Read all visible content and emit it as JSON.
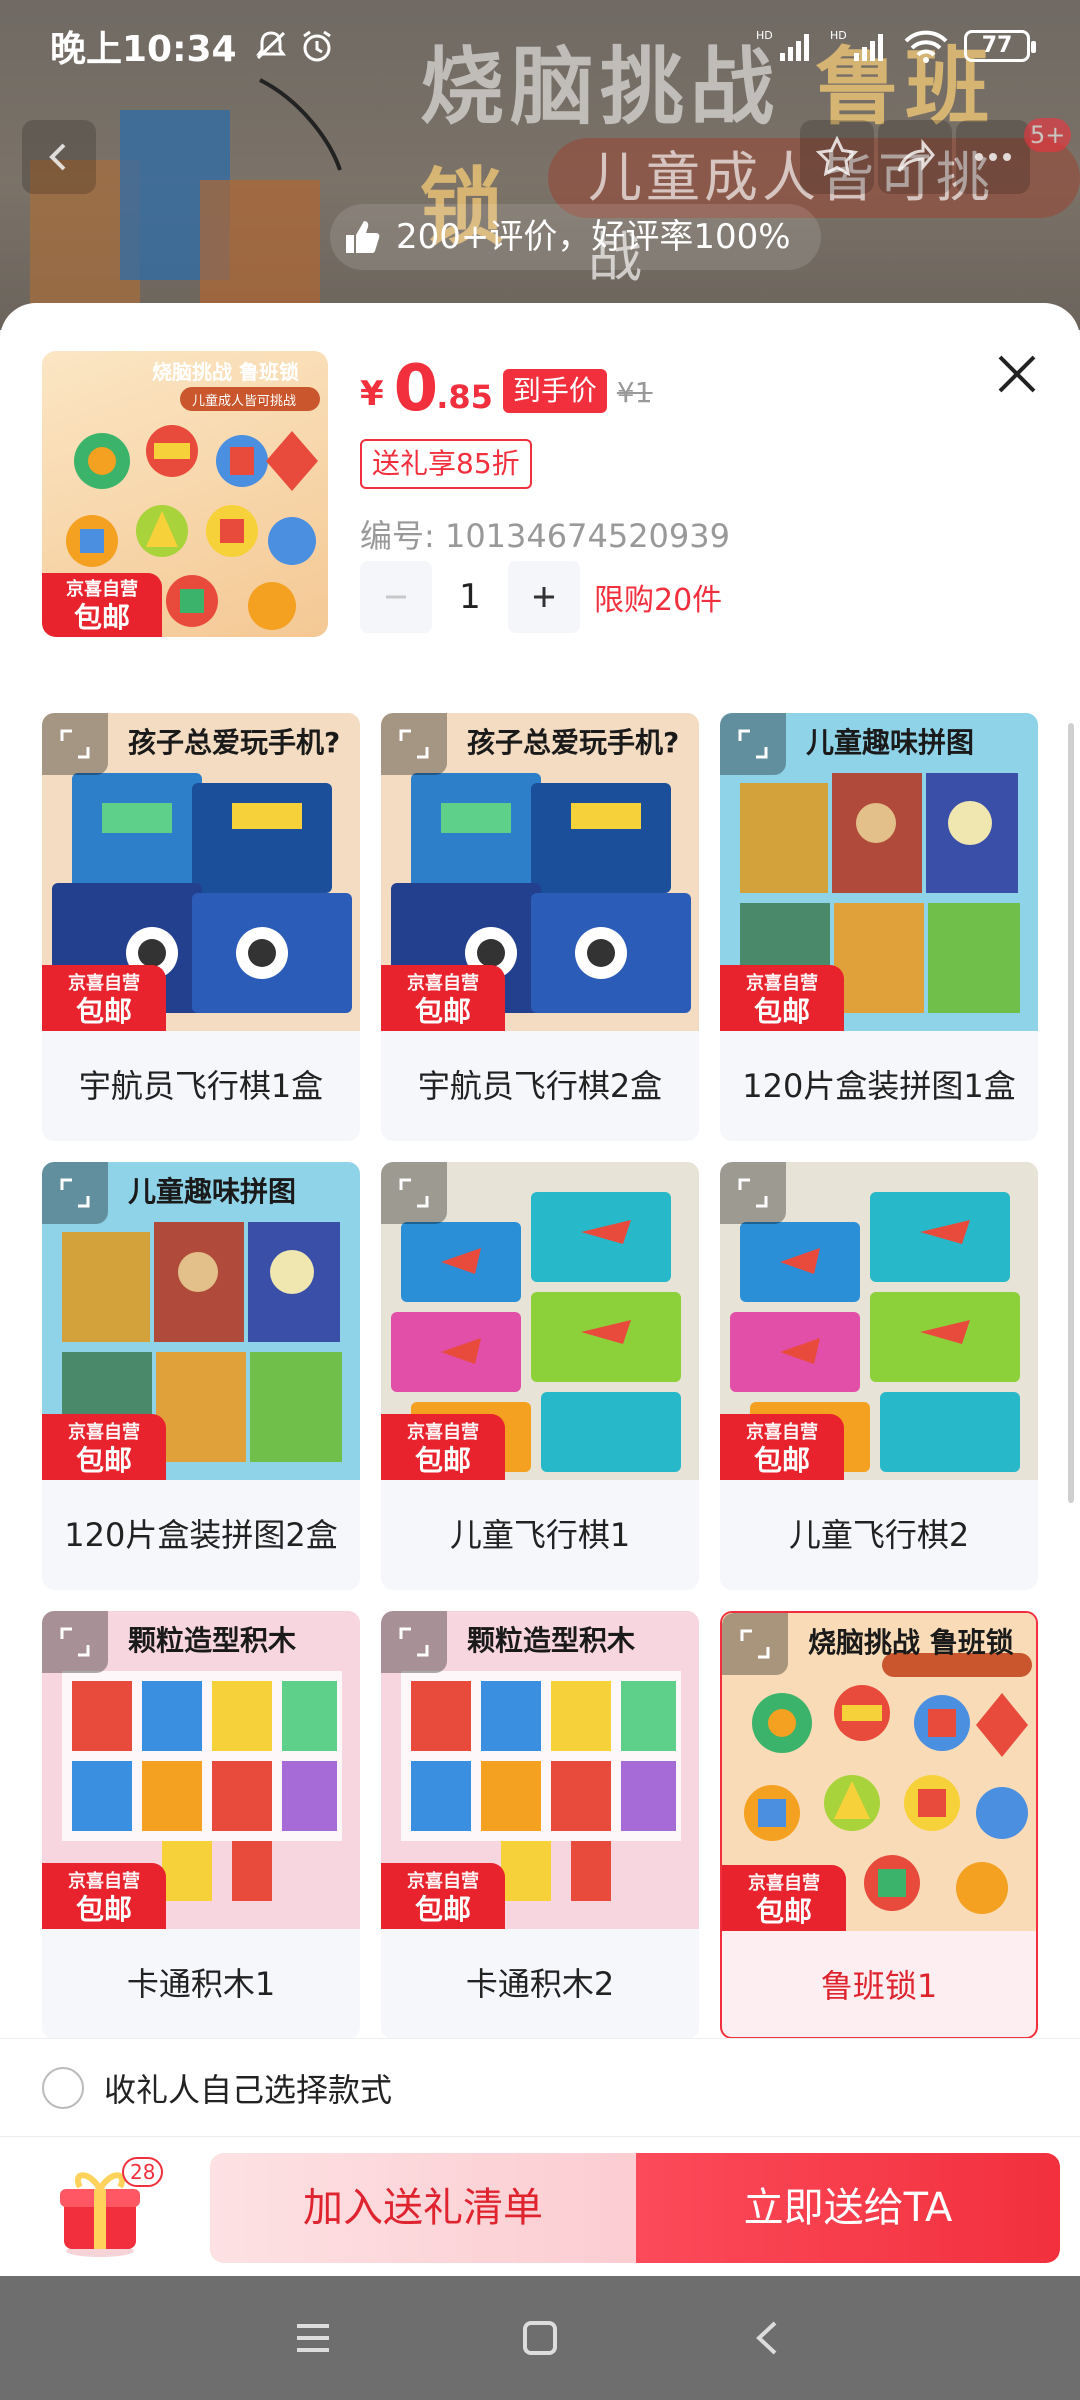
{
  "status_bar": {
    "time": "晚上10:34",
    "battery": "77"
  },
  "backdrop": {
    "title_main": "烧脑挑战",
    "title_highlight": "鲁班锁",
    "subtitle": "儿童成人皆可挑战",
    "review": "200+评价，好评率100%",
    "more_badge": "5+"
  },
  "product": {
    "currency": "¥",
    "price_int": "0",
    "price_dec": ".85",
    "final_price_tag": "到手价",
    "original_price": "¥1",
    "gift_discount": "送礼享85折",
    "sku_label": "编号: 10134674520939",
    "quantity": "1",
    "limit": "限购20件",
    "thumb_caption": "烧脑挑战 鲁班锁",
    "thumb_subcaption": "儿童成人皆可挑战"
  },
  "jd_badge": {
    "line1": "京喜自营",
    "line2": "包邮"
  },
  "options": [
    {
      "label": "宇航员飞行棋1盒",
      "caption": "孩子总爱玩手机?",
      "theme": "astronaut",
      "selected": false
    },
    {
      "label": "宇航员飞行棋2盒",
      "caption": "孩子总爱玩手机?",
      "theme": "astronaut",
      "selected": false
    },
    {
      "label": "120片盒装拼图1盒",
      "caption": "儿童趣味拼图",
      "theme": "puzzle",
      "selected": false
    },
    {
      "label": "120片盒装拼图2盒",
      "caption": "儿童趣味拼图",
      "theme": "puzzle",
      "selected": false
    },
    {
      "label": "儿童飞行棋1",
      "caption": "",
      "theme": "ludo",
      "selected": false
    },
    {
      "label": "儿童飞行棋2",
      "caption": "",
      "theme": "ludo",
      "selected": false
    },
    {
      "label": "卡通积木1",
      "caption": "颗粒造型积木",
      "theme": "blocks",
      "selected": false
    },
    {
      "label": "卡通积木2",
      "caption": "颗粒造型积木",
      "theme": "blocks",
      "selected": false
    },
    {
      "label": "鲁班锁1",
      "caption": "烧脑挑战 鲁班锁",
      "theme": "lock",
      "selected": true
    }
  ],
  "self_choose": "收礼人自己选择款式",
  "bottom": {
    "gift_count": "28",
    "add_label": "加入送礼清单",
    "send_label": "立即送给TA"
  },
  "colors": {
    "accent": "#f2303d",
    "jd_red": "#e8232d"
  }
}
